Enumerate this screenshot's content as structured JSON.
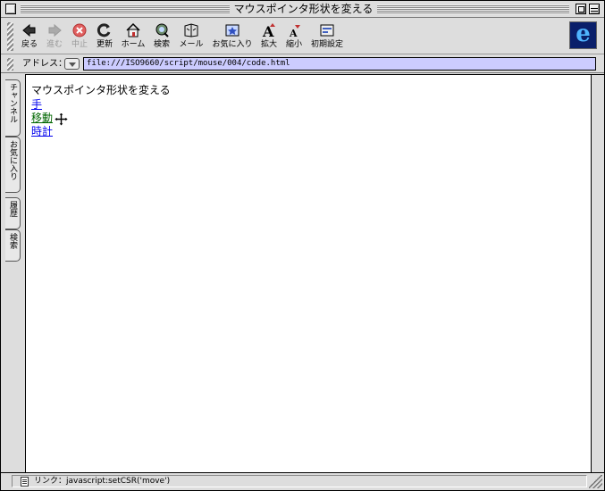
{
  "window": {
    "title": "マウスポインタ形状を変える"
  },
  "toolbar": {
    "buttons": [
      {
        "label": "戻る",
        "icon": "back-arrow-icon",
        "enabled": true
      },
      {
        "label": "進む",
        "icon": "forward-arrow-icon",
        "enabled": false
      },
      {
        "label": "中止",
        "icon": "stop-icon",
        "enabled": false
      },
      {
        "label": "更新",
        "icon": "refresh-icon",
        "enabled": true
      },
      {
        "label": "ホーム",
        "icon": "home-icon",
        "enabled": true
      },
      {
        "label": "検索",
        "icon": "search-icon",
        "enabled": true
      },
      {
        "label": "メール",
        "icon": "mail-icon",
        "enabled": true
      },
      {
        "label": "お気に入り",
        "icon": "favorites-icon",
        "enabled": true
      },
      {
        "label": "拡大",
        "icon": "text-larger-icon",
        "enabled": true
      },
      {
        "label": "縮小",
        "icon": "text-smaller-icon",
        "enabled": true
      },
      {
        "label": "初期設定",
        "icon": "preferences-icon",
        "enabled": true
      }
    ]
  },
  "address": {
    "label": "アドレス：",
    "url": "file:///ISO9660/script/mouse/004/code.html"
  },
  "sidebar": {
    "tabs": [
      {
        "label": "チャンネル"
      },
      {
        "label": "お気に入り"
      },
      {
        "label": "履歴"
      },
      {
        "label": "検索"
      }
    ]
  },
  "page": {
    "heading": "マウスポインタ形状を変える",
    "links": [
      {
        "label": "手"
      },
      {
        "label": "移動"
      },
      {
        "label": "時計"
      }
    ]
  },
  "status": {
    "text": "リンク：javascript:setCSR('move')"
  },
  "colors": {
    "address_field_bg": "#ccccff",
    "link": "#0000ee",
    "visited_link": "#006600",
    "ie_logo_bg": "#0a1f6a"
  }
}
